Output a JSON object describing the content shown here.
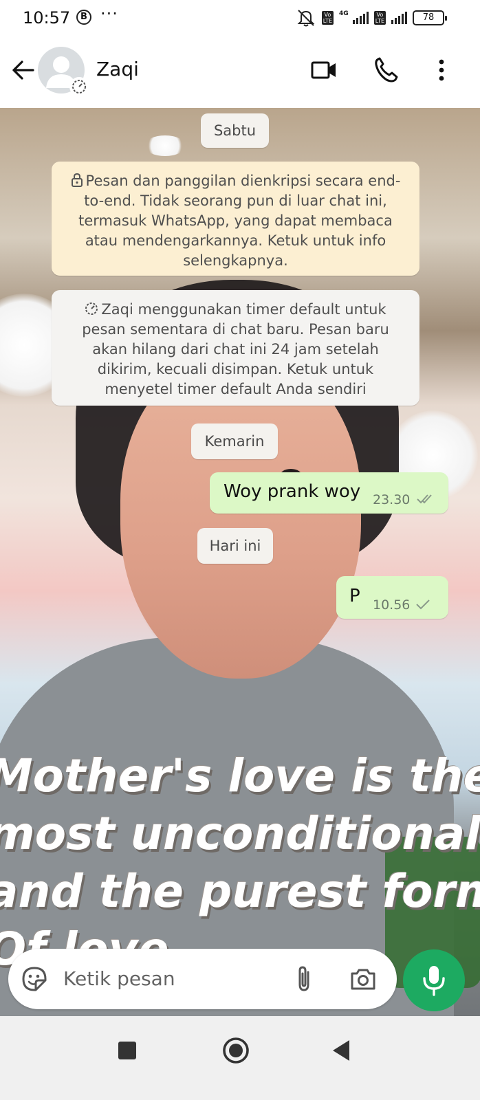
{
  "status_bar": {
    "time": "10:57",
    "app_badge": "B",
    "more": "···",
    "network_label": "4G",
    "lte_label": "Vo LTE",
    "battery": "78"
  },
  "header": {
    "contact_name": "Zaqi",
    "icons": [
      "back-arrow-icon",
      "video-call-icon",
      "voice-call-icon",
      "more-options-icon"
    ]
  },
  "chat": {
    "date_saturday": "Sabtu",
    "encryption_notice": "Pesan dan panggilan dienkripsi secara end-to-end. Tidak seorang pun di luar chat ini, termasuk WhatsApp, yang dapat membaca atau mendengarkannya. Ketuk untuk info selengkapnya.",
    "timer_notice": "Zaqi menggunakan timer default untuk pesan sementara di chat baru. Pesan baru akan hilang dari chat ini 24 jam setelah dikirim, kecuali disimpan. Ketuk untuk menyetel timer default Anda sendiri",
    "date_yesterday": "Kemarin",
    "date_today": "Hari ini",
    "messages": [
      {
        "text": "Woy prank woy",
        "time": "23.30",
        "status": "read"
      },
      {
        "text": "P",
        "time": "10.56",
        "status": "sent"
      }
    ],
    "wallpaper_text": "Mother's love is the\nmost unconditional\nand the purest form\nOf love"
  },
  "composer": {
    "placeholder": "Ketik pesan"
  },
  "colors": {
    "accent": "#1daa61",
    "outgoing_bubble": "#dcf8c6",
    "encryption_bg": "#fcefd2"
  }
}
